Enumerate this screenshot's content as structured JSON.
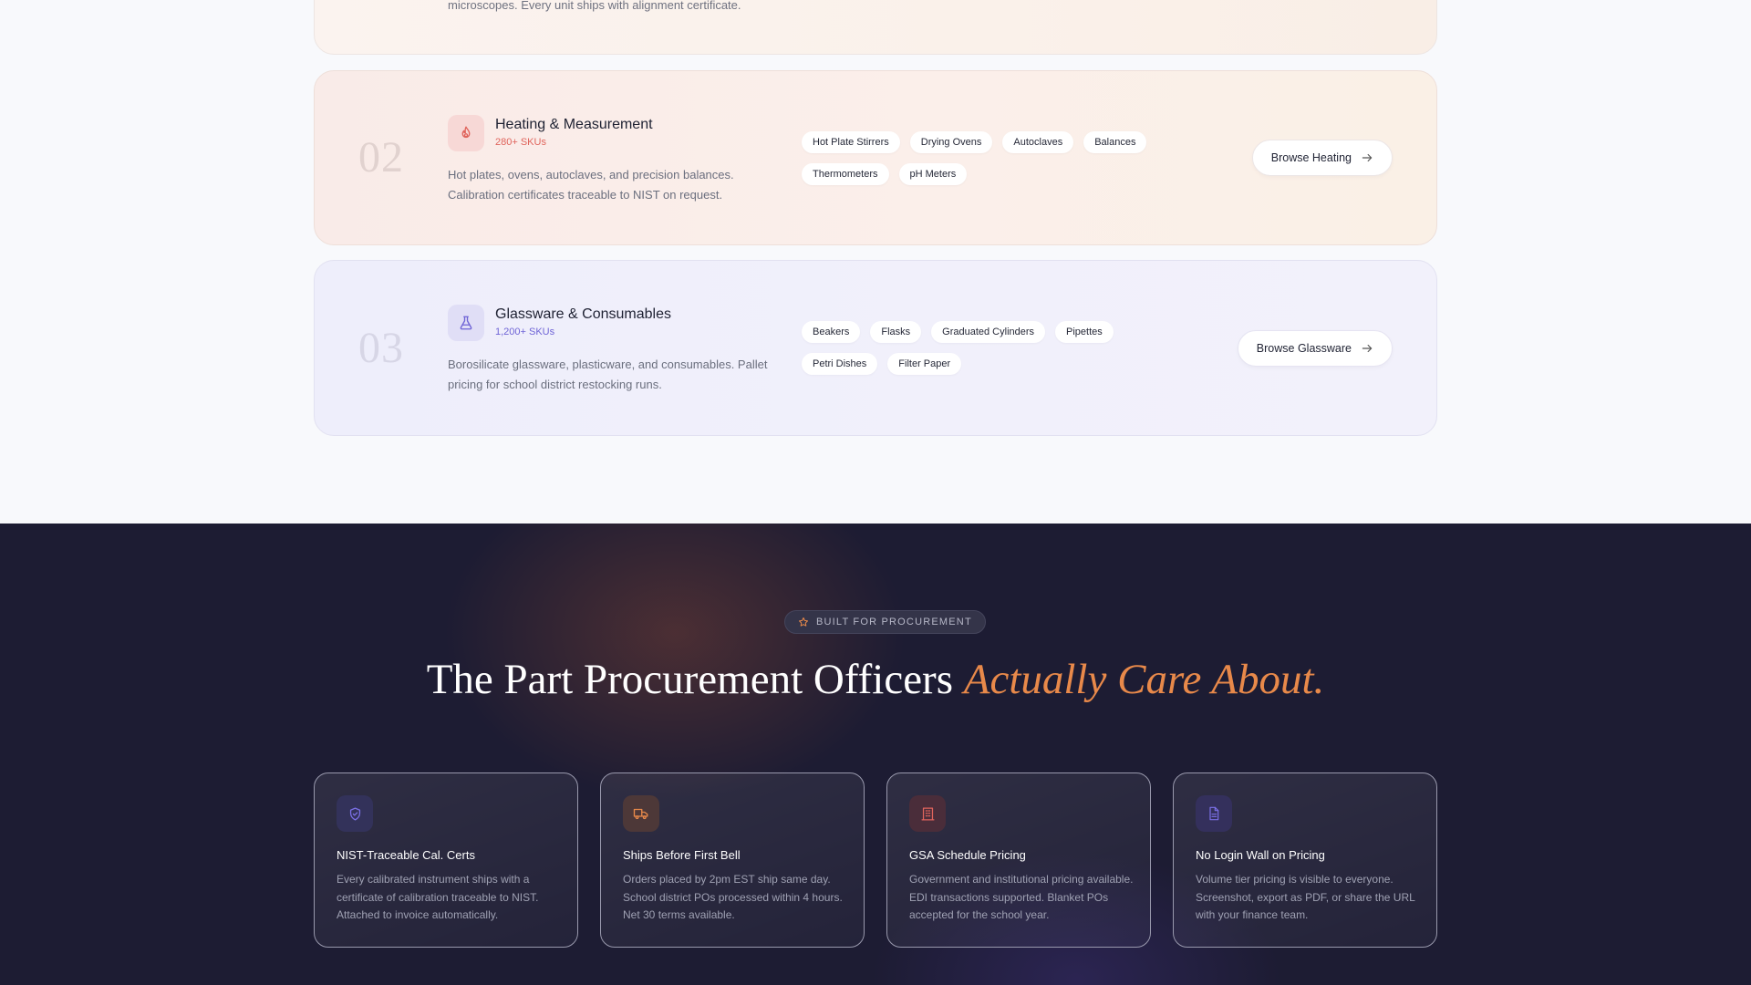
{
  "categories": {
    "first": {
      "description_tail": "microscopes. Every unit ships with alignment certificate."
    },
    "items": [
      {
        "number": "02",
        "title": "Heating & Measurement",
        "sku": "280+ SKUs",
        "description": "Hot plates, ovens, autoclaves, and precision balances. Calibration certificates traceable to NIST on request.",
        "tags": [
          "Hot Plate Stirrers",
          "Drying Ovens",
          "Autoclaves",
          "Balances",
          "Thermometers",
          "pH Meters"
        ],
        "button": "Browse Heating",
        "icon": "flame-icon",
        "accent": "#e0645c"
      },
      {
        "number": "03",
        "title": "Glassware & Consumables",
        "sku": "1,200+ SKUs",
        "description": "Borosilicate glassware, plasticware, and consumables. Pallet pricing for school district restocking runs.",
        "tags": [
          "Beakers",
          "Flasks",
          "Graduated Cylinders",
          "Pipettes",
          "Petri Dishes",
          "Filter Paper"
        ],
        "button": "Browse Glassware",
        "icon": "flask-icon",
        "accent": "#6f64d6"
      }
    ]
  },
  "procurement": {
    "badge": "BUILT FOR PROCUREMENT",
    "headline_plain": "The Part Procurement Officers ",
    "headline_accent": "Actually Care About.",
    "accent_color": "#e8894a",
    "features": [
      {
        "title": "NIST-Traceable Cal. Certs",
        "description": "Every calibrated instrument ships with a certificate of calibration traceable to NIST. Attached to invoice automatically.",
        "icon": "shield-check-icon"
      },
      {
        "title": "Ships Before First Bell",
        "description": "Orders placed by 2pm EST ship same day. School district POs processed within 4 hours. Net 30 terms available.",
        "icon": "truck-icon"
      },
      {
        "title": "GSA Schedule Pricing",
        "description": "Government and institutional pricing available. EDI transactions supported. Blanket POs accepted for the school year.",
        "icon": "building-icon"
      },
      {
        "title": "No Login Wall on Pricing",
        "description": "Volume tier pricing is visible to everyone. Screenshot, export as PDF, or share the URL with your finance team.",
        "icon": "document-icon"
      }
    ]
  }
}
